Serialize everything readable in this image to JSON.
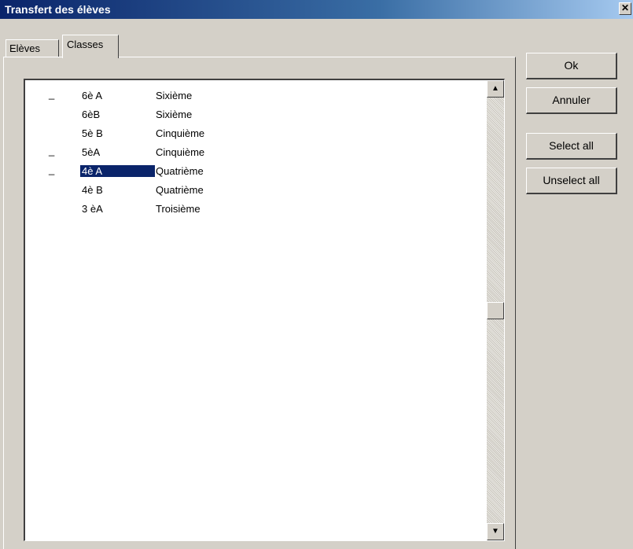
{
  "window": {
    "title": "Transfert des élèves",
    "close_glyph": "✕"
  },
  "tabs": [
    {
      "label": "Elèves",
      "active": false
    },
    {
      "label": "Classes",
      "active": true
    }
  ],
  "list": {
    "rows": [
      {
        "mark": "_",
        "code": "6è A",
        "name": "Sixième",
        "selected": false
      },
      {
        "mark": "",
        "code": "6èB",
        "name": "Sixième",
        "selected": false
      },
      {
        "mark": "",
        "code": "5è B",
        "name": "Cinquième",
        "selected": false
      },
      {
        "mark": "_",
        "code": "5èA",
        "name": "Cinquième",
        "selected": false
      },
      {
        "mark": "_",
        "code": "4è A",
        "name": "Quatrième",
        "selected": true
      },
      {
        "mark": "",
        "code": "4è B",
        "name": "Quatrième",
        "selected": false
      },
      {
        "mark": "",
        "code": "3 èA",
        "name": "Troisième",
        "selected": false
      }
    ],
    "scroll_up_glyph": "▲",
    "scroll_down_glyph": "▼"
  },
  "buttons": {
    "ok": "Ok",
    "cancel": "Annuler",
    "select_all": "Select all",
    "unselect_all": "Unselect all"
  },
  "colors": {
    "title_bar": "#0a246a",
    "selection": "#0a246a",
    "face": "#d4d0c8"
  }
}
